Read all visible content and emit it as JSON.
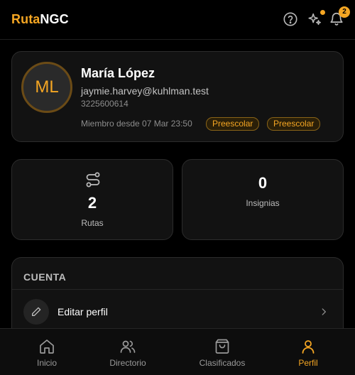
{
  "header": {
    "brand_part1": "Ruta",
    "brand_part2": "NGC",
    "icons": [
      "help-circle-icon",
      "sparkles-icon",
      "bell-icon"
    ],
    "notification_count": "2",
    "accent_color": "#f5a623"
  },
  "profile": {
    "initials": "ML",
    "name": "María López",
    "email": "jaymie.harvey@kuhlman.test",
    "phone": "3225600614",
    "member_since": "Miembro desde 07 Mar 23:50",
    "tags": [
      "Preescolar",
      "Preescolar"
    ]
  },
  "stats": [
    {
      "value": "2",
      "label": "Rutas",
      "icon": "route-icon"
    },
    {
      "value": "0",
      "label": "Insignias"
    }
  ],
  "account": {
    "title": "CUENTA",
    "items": [
      {
        "label": "Editar perfil",
        "icon": "pencil-icon"
      }
    ]
  },
  "nav": {
    "items": [
      {
        "label": "Inicio",
        "icon": "home-icon"
      },
      {
        "label": "Directorio",
        "icon": "users-icon"
      },
      {
        "label": "Clasificados",
        "icon": "shopping-bag-icon"
      },
      {
        "label": "Perfil",
        "icon": "user-icon",
        "active": true
      }
    ]
  }
}
